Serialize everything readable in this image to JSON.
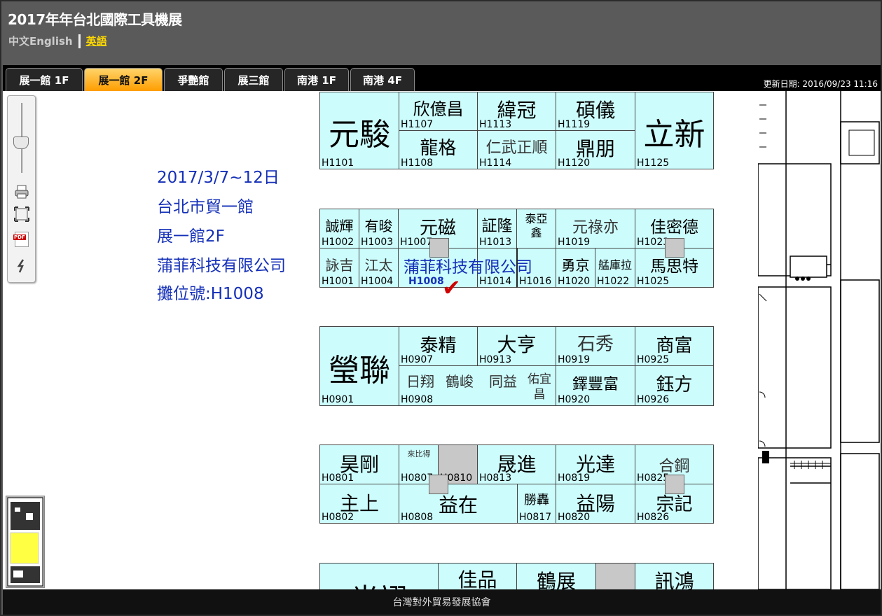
{
  "app": {
    "title": "2017年年台北國際工具機展",
    "lang_chinese": "中文",
    "lang_english": "English",
    "lang_current": "英語"
  },
  "tabs": [
    {
      "label": "展一館 1F",
      "active": false
    },
    {
      "label": "展一館 2F",
      "active": true
    },
    {
      "label": "爭艷館",
      "active": false
    },
    {
      "label": "展三館",
      "active": false
    },
    {
      "label": "南港 1F",
      "active": false
    },
    {
      "label": "南港 4F",
      "active": false
    }
  ],
  "updated": "更新日期: 2016/09/23 11:16",
  "tools": {
    "zoom_icon": "zoom-slider-icon",
    "print_icon": "printer-icon",
    "fit_icon": "fit-screen-icon",
    "pdf_icon": "pdf-icon",
    "pdf_label": "PDF",
    "link_icon": "link-icon"
  },
  "info": {
    "date": "2017/3/7~12日",
    "venue": "台北市貿一館",
    "hall": "展一館2F",
    "company": "蒲菲科技有限公司",
    "booth": "攤位號:H1008"
  },
  "highlight": {
    "name": "蒲菲科技有限公司",
    "no": "H1008",
    "mark": "✔"
  },
  "booths": [
    {
      "name": "元駿",
      "no": "H1101"
    },
    {
      "name": "欣億昌",
      "no": "H1107"
    },
    {
      "name": "緯冠",
      "no": "H1113"
    },
    {
      "name": "碩儀",
      "no": "H1119"
    },
    {
      "name": "立新",
      "no": "H1125"
    },
    {
      "name": "龍格",
      "no": "H1108"
    },
    {
      "name": "仁武正順",
      "no": "H1114"
    },
    {
      "name": "鼎朋",
      "no": "H1120"
    },
    {
      "name": "誠輝",
      "no": "H1002"
    },
    {
      "name": "有晙",
      "no": "H1003"
    },
    {
      "name": "元磁",
      "no": "H1007"
    },
    {
      "name": "証隆",
      "no": "H1013"
    },
    {
      "name": "泰亞鑫",
      "no": ""
    },
    {
      "name": "元祿亦",
      "no": "H1019"
    },
    {
      "name": "佳密德",
      "no": "H1023"
    },
    {
      "name": "詠吉",
      "no": "H1001"
    },
    {
      "name": "江太",
      "no": "H1004"
    },
    {
      "name": "",
      "no": "H1014"
    },
    {
      "name": "",
      "no": "H1016"
    },
    {
      "name": "勇京",
      "no": "H1020"
    },
    {
      "name": "艋庫拉",
      "no": "H1022"
    },
    {
      "name": "馬思特",
      "no": "H1025"
    },
    {
      "name": "瑩聯",
      "no": "H0901"
    },
    {
      "name": "泰精",
      "no": "H0907"
    },
    {
      "name": "大亨",
      "no": "H0913"
    },
    {
      "name": "石秀",
      "no": "H0919"
    },
    {
      "name": "商富",
      "no": "H0925"
    },
    {
      "name": "日翔",
      "no": "H0908"
    },
    {
      "name": "鶴峻",
      "no": ""
    },
    {
      "name": "同益",
      "no": ""
    },
    {
      "name": "佑宜昌",
      "no": ""
    },
    {
      "name": "鐸豐富",
      "no": "H0920"
    },
    {
      "name": "鈺方",
      "no": "H0926"
    },
    {
      "name": "昊剛",
      "no": "H0801"
    },
    {
      "name": "來比得",
      "no": "H0807"
    },
    {
      "name": "",
      "no": "H0810"
    },
    {
      "name": "晟進",
      "no": "H0813"
    },
    {
      "name": "光達",
      "no": "H0819"
    },
    {
      "name": "合鋼",
      "no": "H0825"
    },
    {
      "name": "主上",
      "no": "H0802"
    },
    {
      "name": "益在",
      "no": "H0808"
    },
    {
      "name": "勝轟",
      "no": "H0817"
    },
    {
      "name": "益陽",
      "no": "H0820"
    },
    {
      "name": "宗記",
      "no": "H0826"
    },
    {
      "name": "光翊",
      "no": ""
    },
    {
      "name": "佳品",
      "no": ""
    },
    {
      "name": "鶴展",
      "no": ""
    },
    {
      "name": "訊鴻",
      "no": ""
    }
  ],
  "footer": "台灣對外貿易發展協會"
}
